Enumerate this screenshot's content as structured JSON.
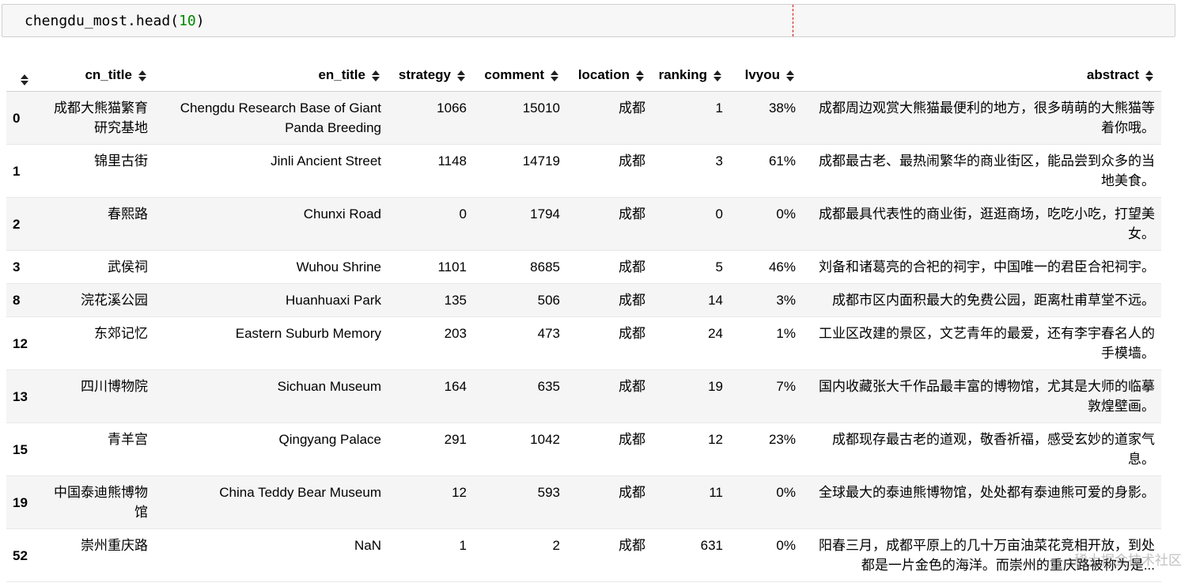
{
  "code": {
    "func": "chengdu_most.head(",
    "arg": "10",
    "close": ")"
  },
  "columns": [
    {
      "key": "index",
      "label": ""
    },
    {
      "key": "cn_title",
      "label": "cn_title"
    },
    {
      "key": "en_title",
      "label": "en_title"
    },
    {
      "key": "strategy",
      "label": "strategy"
    },
    {
      "key": "comment",
      "label": "comment"
    },
    {
      "key": "location",
      "label": "location"
    },
    {
      "key": "ranking",
      "label": "ranking"
    },
    {
      "key": "lvyou",
      "label": "lvyou"
    },
    {
      "key": "abstract",
      "label": "abstract"
    }
  ],
  "rows": [
    {
      "index": "0",
      "cn_title": "成都大熊猫繁育研究基地",
      "en_title": "Chengdu Research Base of Giant Panda Breeding",
      "strategy": "1066",
      "comment": "15010",
      "location": "成都",
      "ranking": "1",
      "lvyou": "38%",
      "abstract": "成都周边观赏大熊猫最便利的地方，很多萌萌的大熊猫等着你哦。"
    },
    {
      "index": "1",
      "cn_title": "锦里古街",
      "en_title": "Jinli Ancient Street",
      "strategy": "1148",
      "comment": "14719",
      "location": "成都",
      "ranking": "3",
      "lvyou": "61%",
      "abstract": "成都最古老、最热闹繁华的商业街区，能品尝到众多的当地美食。"
    },
    {
      "index": "2",
      "cn_title": "春熙路",
      "en_title": "Chunxi Road",
      "strategy": "0",
      "comment": "1794",
      "location": "成都",
      "ranking": "0",
      "lvyou": "0%",
      "abstract": "成都最具代表性的商业街，逛逛商场，吃吃小吃，打望美女。"
    },
    {
      "index": "3",
      "cn_title": "武侯祠",
      "en_title": "Wuhou Shrine",
      "strategy": "1101",
      "comment": "8685",
      "location": "成都",
      "ranking": "5",
      "lvyou": "46%",
      "abstract": "刘备和诸葛亮的合祀的祠宇，中国唯一的君臣合祀祠宇。"
    },
    {
      "index": "8",
      "cn_title": "浣花溪公园",
      "en_title": "Huanhuaxi Park",
      "strategy": "135",
      "comment": "506",
      "location": "成都",
      "ranking": "14",
      "lvyou": "3%",
      "abstract": "成都市区内面积最大的免费公园，距离杜甫草堂不远。"
    },
    {
      "index": "12",
      "cn_title": "东郊记忆",
      "en_title": "Eastern Suburb Memory",
      "strategy": "203",
      "comment": "473",
      "location": "成都",
      "ranking": "24",
      "lvyou": "1%",
      "abstract": "工业区改建的景区，文艺青年的最爱，还有李宇春名人的手模墙。"
    },
    {
      "index": "13",
      "cn_title": "四川博物院",
      "en_title": "Sichuan Museum",
      "strategy": "164",
      "comment": "635",
      "location": "成都",
      "ranking": "19",
      "lvyou": "7%",
      "abstract": "国内收藏张大千作品最丰富的博物馆，尤其是大师的临摹敦煌壁画。"
    },
    {
      "index": "15",
      "cn_title": "青羊宫",
      "en_title": "Qingyang Palace",
      "strategy": "291",
      "comment": "1042",
      "location": "成都",
      "ranking": "12",
      "lvyou": "23%",
      "abstract": "成都现存最古老的道观，敬香祈福，感受玄妙的道家气息。"
    },
    {
      "index": "19",
      "cn_title": "中国泰迪熊博物馆",
      "en_title": "China Teddy Bear Museum",
      "strategy": "12",
      "comment": "593",
      "location": "成都",
      "ranking": "11",
      "lvyou": "0%",
      "abstract": "全球最大的泰迪熊博物馆，处处都有泰迪熊可爱的身影。"
    },
    {
      "index": "52",
      "cn_title": "崇州重庆路",
      "en_title": "NaN",
      "strategy": "1",
      "comment": "2",
      "location": "成都",
      "ranking": "631",
      "lvyou": "0%",
      "abstract": "阳春三月，成都平原上的几十万亩油菜花竞相开放，到处都是一片金色的海洋。而崇州的重庆路被称为是..."
    }
  ],
  "watermark": "稀土掘金技术社区",
  "icons": {
    "sort": "sort-icon"
  }
}
